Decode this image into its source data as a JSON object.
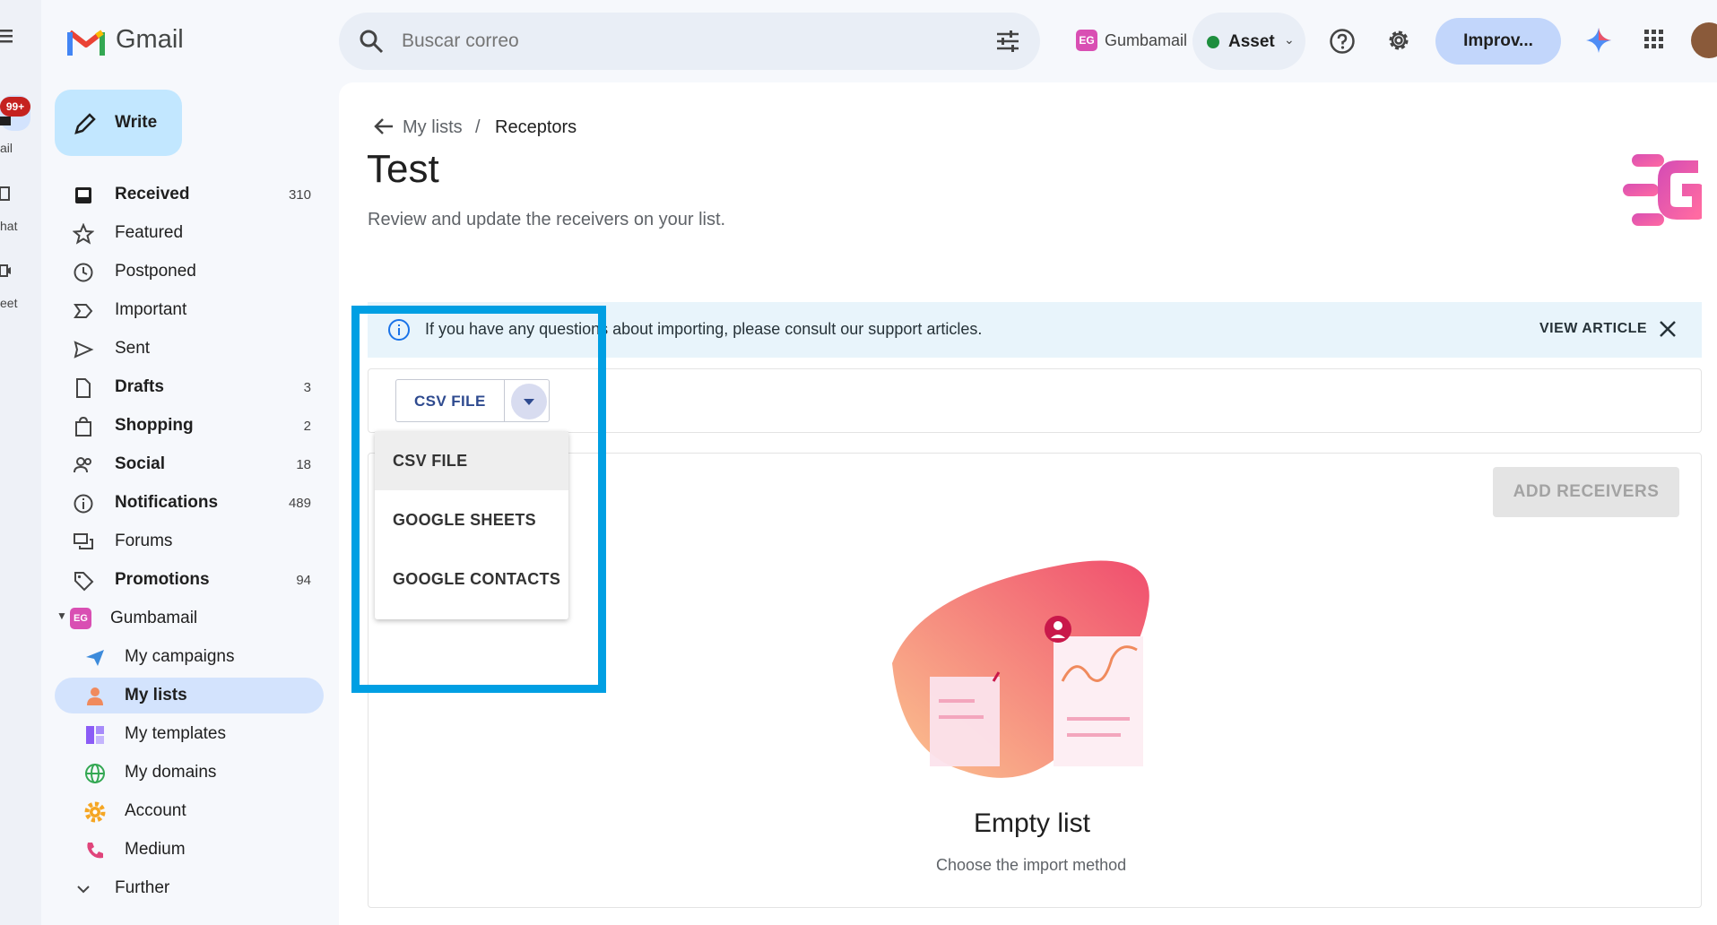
{
  "rail": {
    "badge": "99+",
    "items": [
      {
        "label": "ail"
      },
      {
        "label": "hat"
      },
      {
        "label": "eet"
      }
    ]
  },
  "header": {
    "app_name": "Gmail",
    "search_placeholder": "Buscar correo",
    "gumbamail_label": "Gumbamail",
    "gumbamail_mark": "EG",
    "status_label": "Asset",
    "status_color": "#1e8e3e",
    "improve_label": "Improv..."
  },
  "sidebar": {
    "write_label": "Write",
    "items": [
      {
        "label": "Received",
        "count": "310",
        "icon": "inbox-icon",
        "bold": true
      },
      {
        "label": "Featured",
        "count": "",
        "icon": "star-icon",
        "bold": false
      },
      {
        "label": "Postponed",
        "count": "",
        "icon": "clock-icon",
        "bold": false
      },
      {
        "label": "Important",
        "count": "",
        "icon": "important-icon",
        "bold": false
      },
      {
        "label": "Sent",
        "count": "",
        "icon": "send-icon",
        "bold": false
      },
      {
        "label": "Drafts",
        "count": "3",
        "icon": "draft-icon",
        "bold": true
      },
      {
        "label": "Shopping",
        "count": "2",
        "icon": "shopping-icon",
        "bold": true
      },
      {
        "label": "Social",
        "count": "18",
        "icon": "people-icon",
        "bold": true
      },
      {
        "label": "Notifications",
        "count": "489",
        "icon": "info-icon",
        "bold": true
      },
      {
        "label": "Forums",
        "count": "",
        "icon": "forum-icon",
        "bold": false
      },
      {
        "label": "Promotions",
        "count": "94",
        "icon": "tag-icon",
        "bold": true
      }
    ],
    "gumbamail_group": {
      "label": "Gumbamail",
      "items": [
        {
          "label": "My campaigns",
          "icon": "paper-plane-icon"
        },
        {
          "label": "My lists",
          "icon": "person-icon",
          "active": true
        },
        {
          "label": "My templates",
          "icon": "template-icon"
        },
        {
          "label": "My domains",
          "icon": "globe-icon"
        },
        {
          "label": "Account",
          "icon": "gear-icon"
        },
        {
          "label": "Medium",
          "icon": "phone-icon"
        }
      ]
    },
    "further_label": "Further"
  },
  "main": {
    "breadcrumb_parent": "My lists",
    "breadcrumb_sep": "/",
    "breadcrumb_current": "Receptors",
    "title": "Test",
    "subtitle": "Review and update the receivers on your list.",
    "info_message": "If you have any questions about importing, please consult our support articles.",
    "view_article_label": "VIEW ARTICLE",
    "import_button_label": "CSV FILE",
    "add_receivers_label": "ADD RECEIVERS",
    "empty_title": "Empty list",
    "empty_subtitle": "Choose the import method"
  },
  "import_menu": {
    "options": [
      {
        "label": "CSV FILE",
        "selected": true
      },
      {
        "label": "GOOGLE SHEETS",
        "selected": false
      },
      {
        "label": "GOOGLE CONTACTS",
        "selected": false
      }
    ]
  },
  "colors": {
    "accent": "#0b57d0",
    "highlight": "#009fe3",
    "active_nav": "#d3e3fd",
    "write_button": "#c2e7ff",
    "brand_pink": "#d94fb3"
  }
}
